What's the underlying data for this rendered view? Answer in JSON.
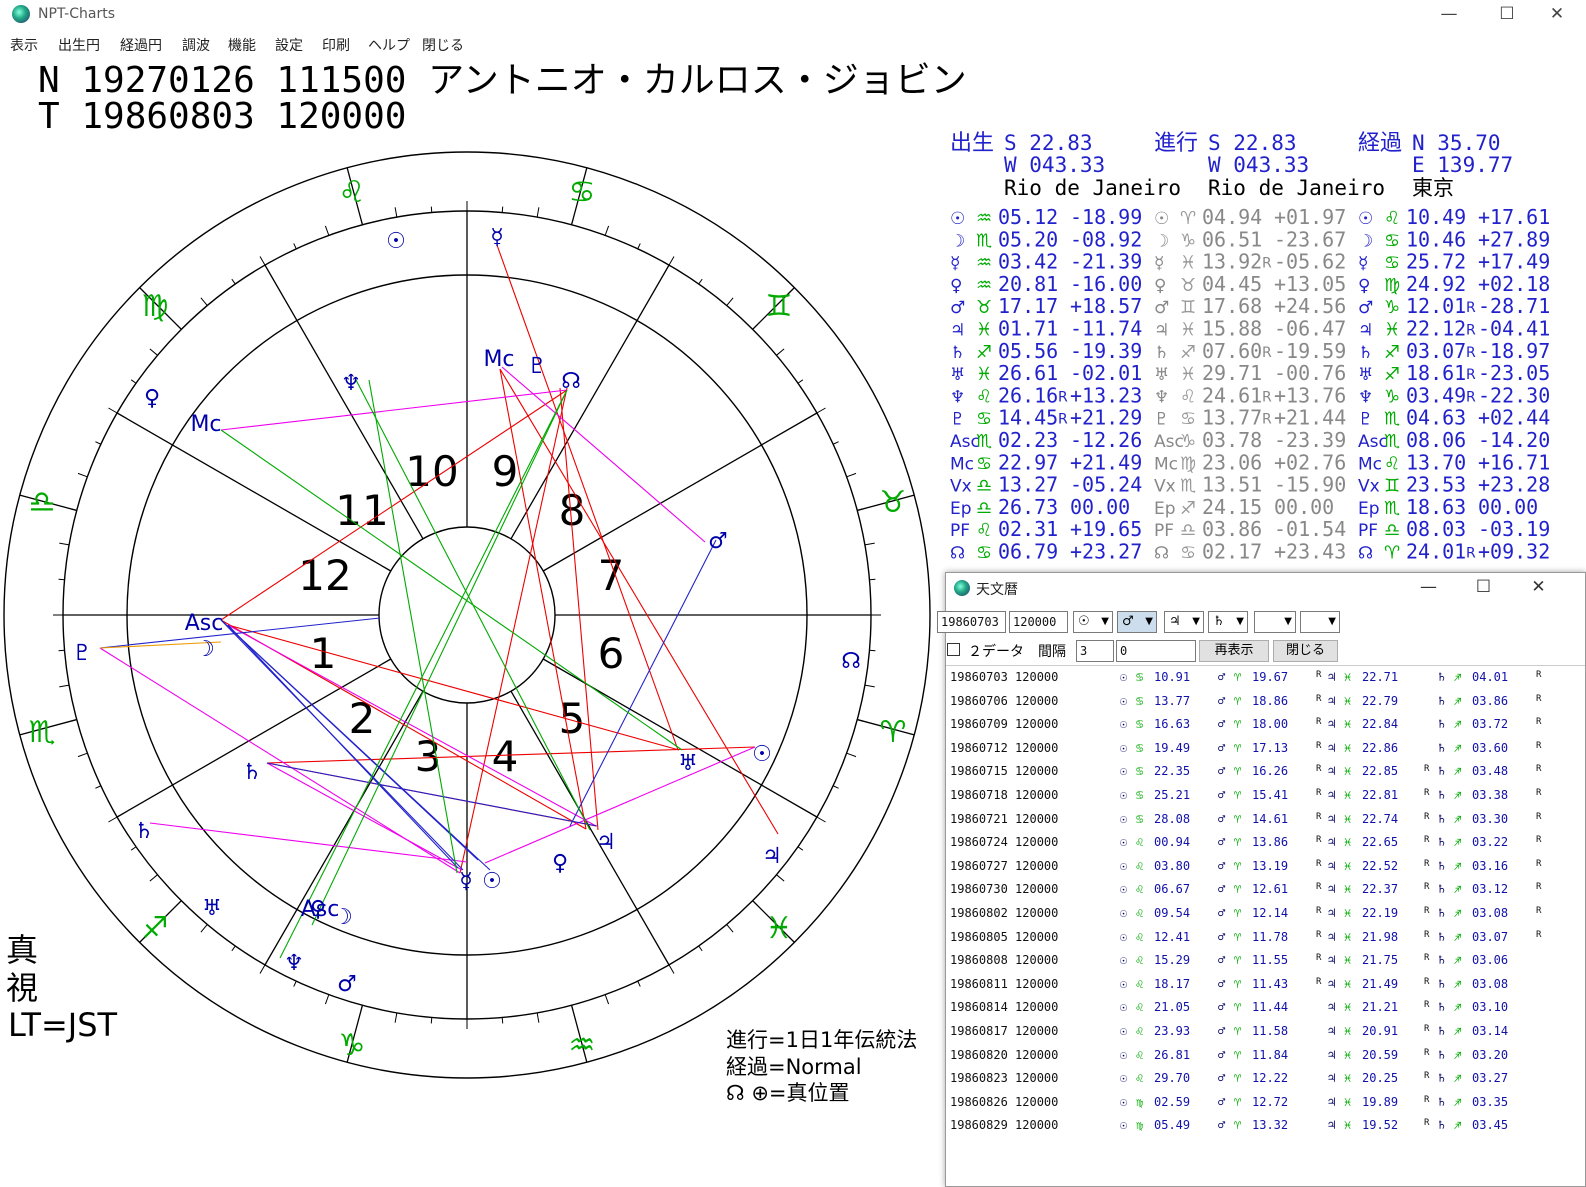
{
  "window": {
    "title": "NPT-Charts",
    "minimize": "—",
    "maximize": "☐",
    "close": "✕"
  },
  "menu": [
    "表示",
    "出生円",
    "経過円",
    "調波",
    "機能",
    "設定",
    "印刷",
    "ヘルプ",
    "閉じる"
  ],
  "header": {
    "natal_line": "N 19270126 111500 アントニオ・カルロス・ジョビン",
    "transit_line": "T 19860803 120000"
  },
  "locations": [
    {
      "label": "出生",
      "lat": "S  22.83",
      "lon": "W 043.33",
      "place": "Rio de Janeiro"
    },
    {
      "label": "進行",
      "lat": "S  22.83",
      "lon": "W 043.33",
      "place": "Rio de Janeiro"
    },
    {
      "label": "経過",
      "lat": "N  35.70",
      "lon": "E 139.77",
      "place": "東京"
    }
  ],
  "planet_table": {
    "glyphs": [
      "☉",
      "☽",
      "☿",
      "♀",
      "♂",
      "♃",
      "♄",
      "♅",
      "♆",
      "♇",
      "Asc",
      "Mc",
      "Vx",
      "Ep",
      "PF",
      "☊"
    ],
    "columns": [
      {
        "rows": [
          [
            "♒",
            "05.12",
            " ",
            "-18.99"
          ],
          [
            "♏",
            "05.20",
            " ",
            "-08.92"
          ],
          [
            "♒",
            "03.42",
            " ",
            "-21.39"
          ],
          [
            "♒",
            "20.81",
            " ",
            "-16.00"
          ],
          [
            "♉",
            "17.17",
            " ",
            "+18.57"
          ],
          [
            "♓",
            "01.71",
            " ",
            "-11.74"
          ],
          [
            "♐",
            "05.56",
            " ",
            "-19.39"
          ],
          [
            "♓",
            "26.61",
            " ",
            "-02.01"
          ],
          [
            "♌",
            "26.16",
            "R",
            "+13.23"
          ],
          [
            "♋",
            "14.45",
            "R",
            "+21.29"
          ],
          [
            "♏",
            "02.23",
            " ",
            "-12.26"
          ],
          [
            "♋",
            "22.97",
            " ",
            "+21.49"
          ],
          [
            "♎",
            "13.27",
            " ",
            "-05.24"
          ],
          [
            "♎",
            "26.73",
            " ",
            "00.00"
          ],
          [
            "♌",
            "02.31",
            " ",
            "+19.65"
          ],
          [
            "♋",
            "06.79",
            " ",
            "+23.27"
          ]
        ]
      },
      {
        "rows": [
          [
            "♈",
            "04.94",
            " ",
            "+01.97"
          ],
          [
            "♑",
            "06.51",
            " ",
            "-23.67"
          ],
          [
            "♓",
            "13.92",
            "R",
            "-05.62"
          ],
          [
            "♉",
            "04.45",
            " ",
            "+13.05"
          ],
          [
            "♊",
            "17.68",
            " ",
            "+24.56"
          ],
          [
            "♓",
            "15.88",
            " ",
            "-06.47"
          ],
          [
            "♐",
            "07.60",
            "R",
            "-19.59"
          ],
          [
            "♓",
            "29.71",
            " ",
            "-00.76"
          ],
          [
            "♌",
            "24.61",
            "R",
            "+13.76"
          ],
          [
            "♋",
            "13.77",
            "R",
            "+21.44"
          ],
          [
            "♑",
            "03.78",
            " ",
            "-23.39"
          ],
          [
            "♍",
            "23.06",
            " ",
            "+02.76"
          ],
          [
            "♏",
            "13.51",
            " ",
            "-15.90"
          ],
          [
            "♐",
            "24.15",
            " ",
            "00.00"
          ],
          [
            "♎",
            "03.86",
            " ",
            "-01.54"
          ],
          [
            "♋",
            "02.17",
            " ",
            "+23.43"
          ]
        ]
      },
      {
        "rows": [
          [
            "♌",
            "10.49",
            " ",
            "+17.61"
          ],
          [
            "♋",
            "10.46",
            " ",
            "+27.89"
          ],
          [
            "♋",
            "25.72",
            " ",
            "+17.49"
          ],
          [
            "♍",
            "24.92",
            " ",
            "+02.18"
          ],
          [
            "♑",
            "12.01",
            "R",
            "-28.71"
          ],
          [
            "♓",
            "22.12",
            "R",
            "-04.41"
          ],
          [
            "♐",
            "03.07",
            "R",
            "-18.97"
          ],
          [
            "♐",
            "18.61",
            "R",
            "-23.05"
          ],
          [
            "♑",
            "03.49",
            "R",
            "-22.30"
          ],
          [
            "♏",
            "04.63",
            " ",
            "+02.44"
          ],
          [
            "♏",
            "08.06",
            " ",
            "-14.20"
          ],
          [
            "♌",
            "13.70",
            " ",
            "+16.71"
          ],
          [
            "♊",
            "23.53",
            " ",
            "+23.28"
          ],
          [
            "♏",
            "18.63",
            " ",
            "00.00"
          ],
          [
            "♎",
            "08.03",
            " ",
            "-03.19"
          ],
          [
            "♈",
            "24.01",
            "R",
            "+09.32"
          ]
        ]
      }
    ]
  },
  "chart": {
    "house_numbers": [
      "1",
      "2",
      "3",
      "4",
      "5",
      "6",
      "7",
      "8",
      "9",
      "10",
      "11",
      "12"
    ],
    "zodiac": [
      "♌",
      "♋",
      "♊",
      "♉",
      "♈",
      "♓",
      "♒",
      "♑",
      "♐",
      "♏",
      "♎",
      "♍"
    ],
    "labels": [
      "☿",
      "☉",
      "♇",
      "☊",
      "Mc",
      "♆",
      "♀",
      "Mc",
      "♂",
      "Asc",
      "☽",
      "♇",
      "☊",
      "♀",
      "☉",
      "♄",
      "♅",
      "♄",
      "♅",
      "♃",
      "♃",
      "☿",
      "☉",
      "♀",
      "Asc",
      "☽",
      "♆",
      "♂"
    ]
  },
  "notes": {
    "mode": [
      "真",
      "視"
    ],
    "tz": "LT=JST",
    "progression": "進行=1日1年伝統法",
    "transit": "経過=Normal",
    "node": "☊ ⊕=真位置"
  },
  "ephemeris": {
    "title": "天文暦",
    "date_field": "19860703",
    "time_field": "120000",
    "selectors": [
      "☉",
      "♂",
      "♃",
      "♄",
      "",
      ""
    ],
    "two_data_label": "２データ",
    "interval_label": "間隔",
    "interval_value": "3",
    "offset_value": "0",
    "redisplay_button": "再表示",
    "close_button": "閉じる",
    "rows": [
      [
        "19860703 120000",
        "♋",
        "10.91",
        "♈",
        "19.67",
        "R",
        "♓",
        "22.71",
        " ",
        "♐",
        "04.01",
        "R"
      ],
      [
        "19860706 120000",
        "♋",
        "13.77",
        "♈",
        "18.86",
        "R",
        "♓",
        "22.79",
        " ",
        "♐",
        "03.86",
        "R"
      ],
      [
        "19860709 120000",
        "♋",
        "16.63",
        "♈",
        "18.00",
        "R",
        "♓",
        "22.84",
        " ",
        "♐",
        "03.72",
        "R"
      ],
      [
        "19860712 120000",
        "♋",
        "19.49",
        "♈",
        "17.13",
        "R",
        "♓",
        "22.86",
        " ",
        "♐",
        "03.60",
        "R"
      ],
      [
        "19860715 120000",
        "♋",
        "22.35",
        "♈",
        "16.26",
        "R",
        "♓",
        "22.85",
        "R",
        "♐",
        "03.48",
        "R"
      ],
      [
        "19860718 120000",
        "♋",
        "25.21",
        "♈",
        "15.41",
        "R",
        "♓",
        "22.81",
        "R",
        "♐",
        "03.38",
        "R"
      ],
      [
        "19860721 120000",
        "♋",
        "28.08",
        "♈",
        "14.61",
        "R",
        "♓",
        "22.74",
        "R",
        "♐",
        "03.30",
        "R"
      ],
      [
        "19860724 120000",
        "♌",
        "00.94",
        "♈",
        "13.86",
        "R",
        "♓",
        "22.65",
        "R",
        "♐",
        "03.22",
        "R"
      ],
      [
        "19860727 120000",
        "♌",
        "03.80",
        "♈",
        "13.19",
        "R",
        "♓",
        "22.52",
        "R",
        "♐",
        "03.16",
        "R"
      ],
      [
        "19860730 120000",
        "♌",
        "06.67",
        "♈",
        "12.61",
        "R",
        "♓",
        "22.37",
        "R",
        "♐",
        "03.12",
        "R"
      ],
      [
        "19860802 120000",
        "♌",
        "09.54",
        "♈",
        "12.14",
        "R",
        "♓",
        "22.19",
        "R",
        "♐",
        "03.08",
        "R"
      ],
      [
        "19860805 120000",
        "♌",
        "12.41",
        "♈",
        "11.78",
        "R",
        "♓",
        "21.98",
        "R",
        "♐",
        "03.07",
        "R"
      ],
      [
        "19860808 120000",
        "♌",
        "15.29",
        "♈",
        "11.55",
        "R",
        "♓",
        "21.75",
        "R",
        "♐",
        "03.06",
        " "
      ],
      [
        "19860811 120000",
        "♌",
        "18.17",
        "♈",
        "11.43",
        "R",
        "♓",
        "21.49",
        "R",
        "♐",
        "03.08",
        " "
      ],
      [
        "19860814 120000",
        "♌",
        "21.05",
        "♈",
        "11.44",
        " ",
        "♓",
        "21.21",
        "R",
        "♐",
        "03.10",
        " "
      ],
      [
        "19860817 120000",
        "♌",
        "23.93",
        "♈",
        "11.58",
        " ",
        "♓",
        "20.91",
        "R",
        "♐",
        "03.14",
        " "
      ],
      [
        "19860820 120000",
        "♌",
        "26.81",
        "♈",
        "11.84",
        " ",
        "♓",
        "20.59",
        "R",
        "♐",
        "03.20",
        " "
      ],
      [
        "19860823 120000",
        "♌",
        "29.70",
        "♈",
        "12.22",
        " ",
        "♓",
        "20.25",
        "R",
        "♐",
        "03.27",
        " "
      ],
      [
        "19860826 120000",
        "♍",
        "02.59",
        "♈",
        "12.72",
        " ",
        "♓",
        "19.89",
        "R",
        "♐",
        "03.35",
        " "
      ],
      [
        "19860829 120000",
        "♍",
        "05.49",
        "♈",
        "13.32",
        " ",
        "♓",
        "19.52",
        "R",
        "♐",
        "03.45",
        " "
      ]
    ]
  }
}
